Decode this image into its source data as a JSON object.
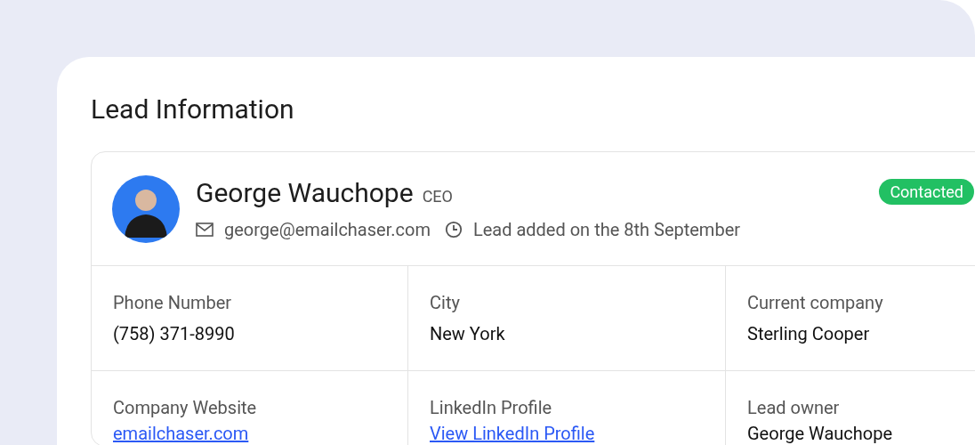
{
  "title": "Lead Information",
  "lead": {
    "name": "George Wauchope",
    "role": "CEO",
    "email": "george@emailchaser.com",
    "added": "Lead added on the 8th September",
    "status": {
      "label": "Contacted",
      "color": "#22c063"
    }
  },
  "fields": [
    {
      "label": "Phone Number",
      "value": "(758) 371-8990",
      "kind": "text"
    },
    {
      "label": "City",
      "value": "New York",
      "kind": "text"
    },
    {
      "label": "Current company",
      "value": "Sterling Cooper",
      "kind": "text"
    },
    {
      "label": "Company Website",
      "value": "emailchaser.com",
      "kind": "link"
    },
    {
      "label": "LinkedIn Profile",
      "value": "View LinkedIn Profile",
      "kind": "link"
    },
    {
      "label": "Lead owner",
      "value": "George Wauchope",
      "kind": "text"
    }
  ]
}
